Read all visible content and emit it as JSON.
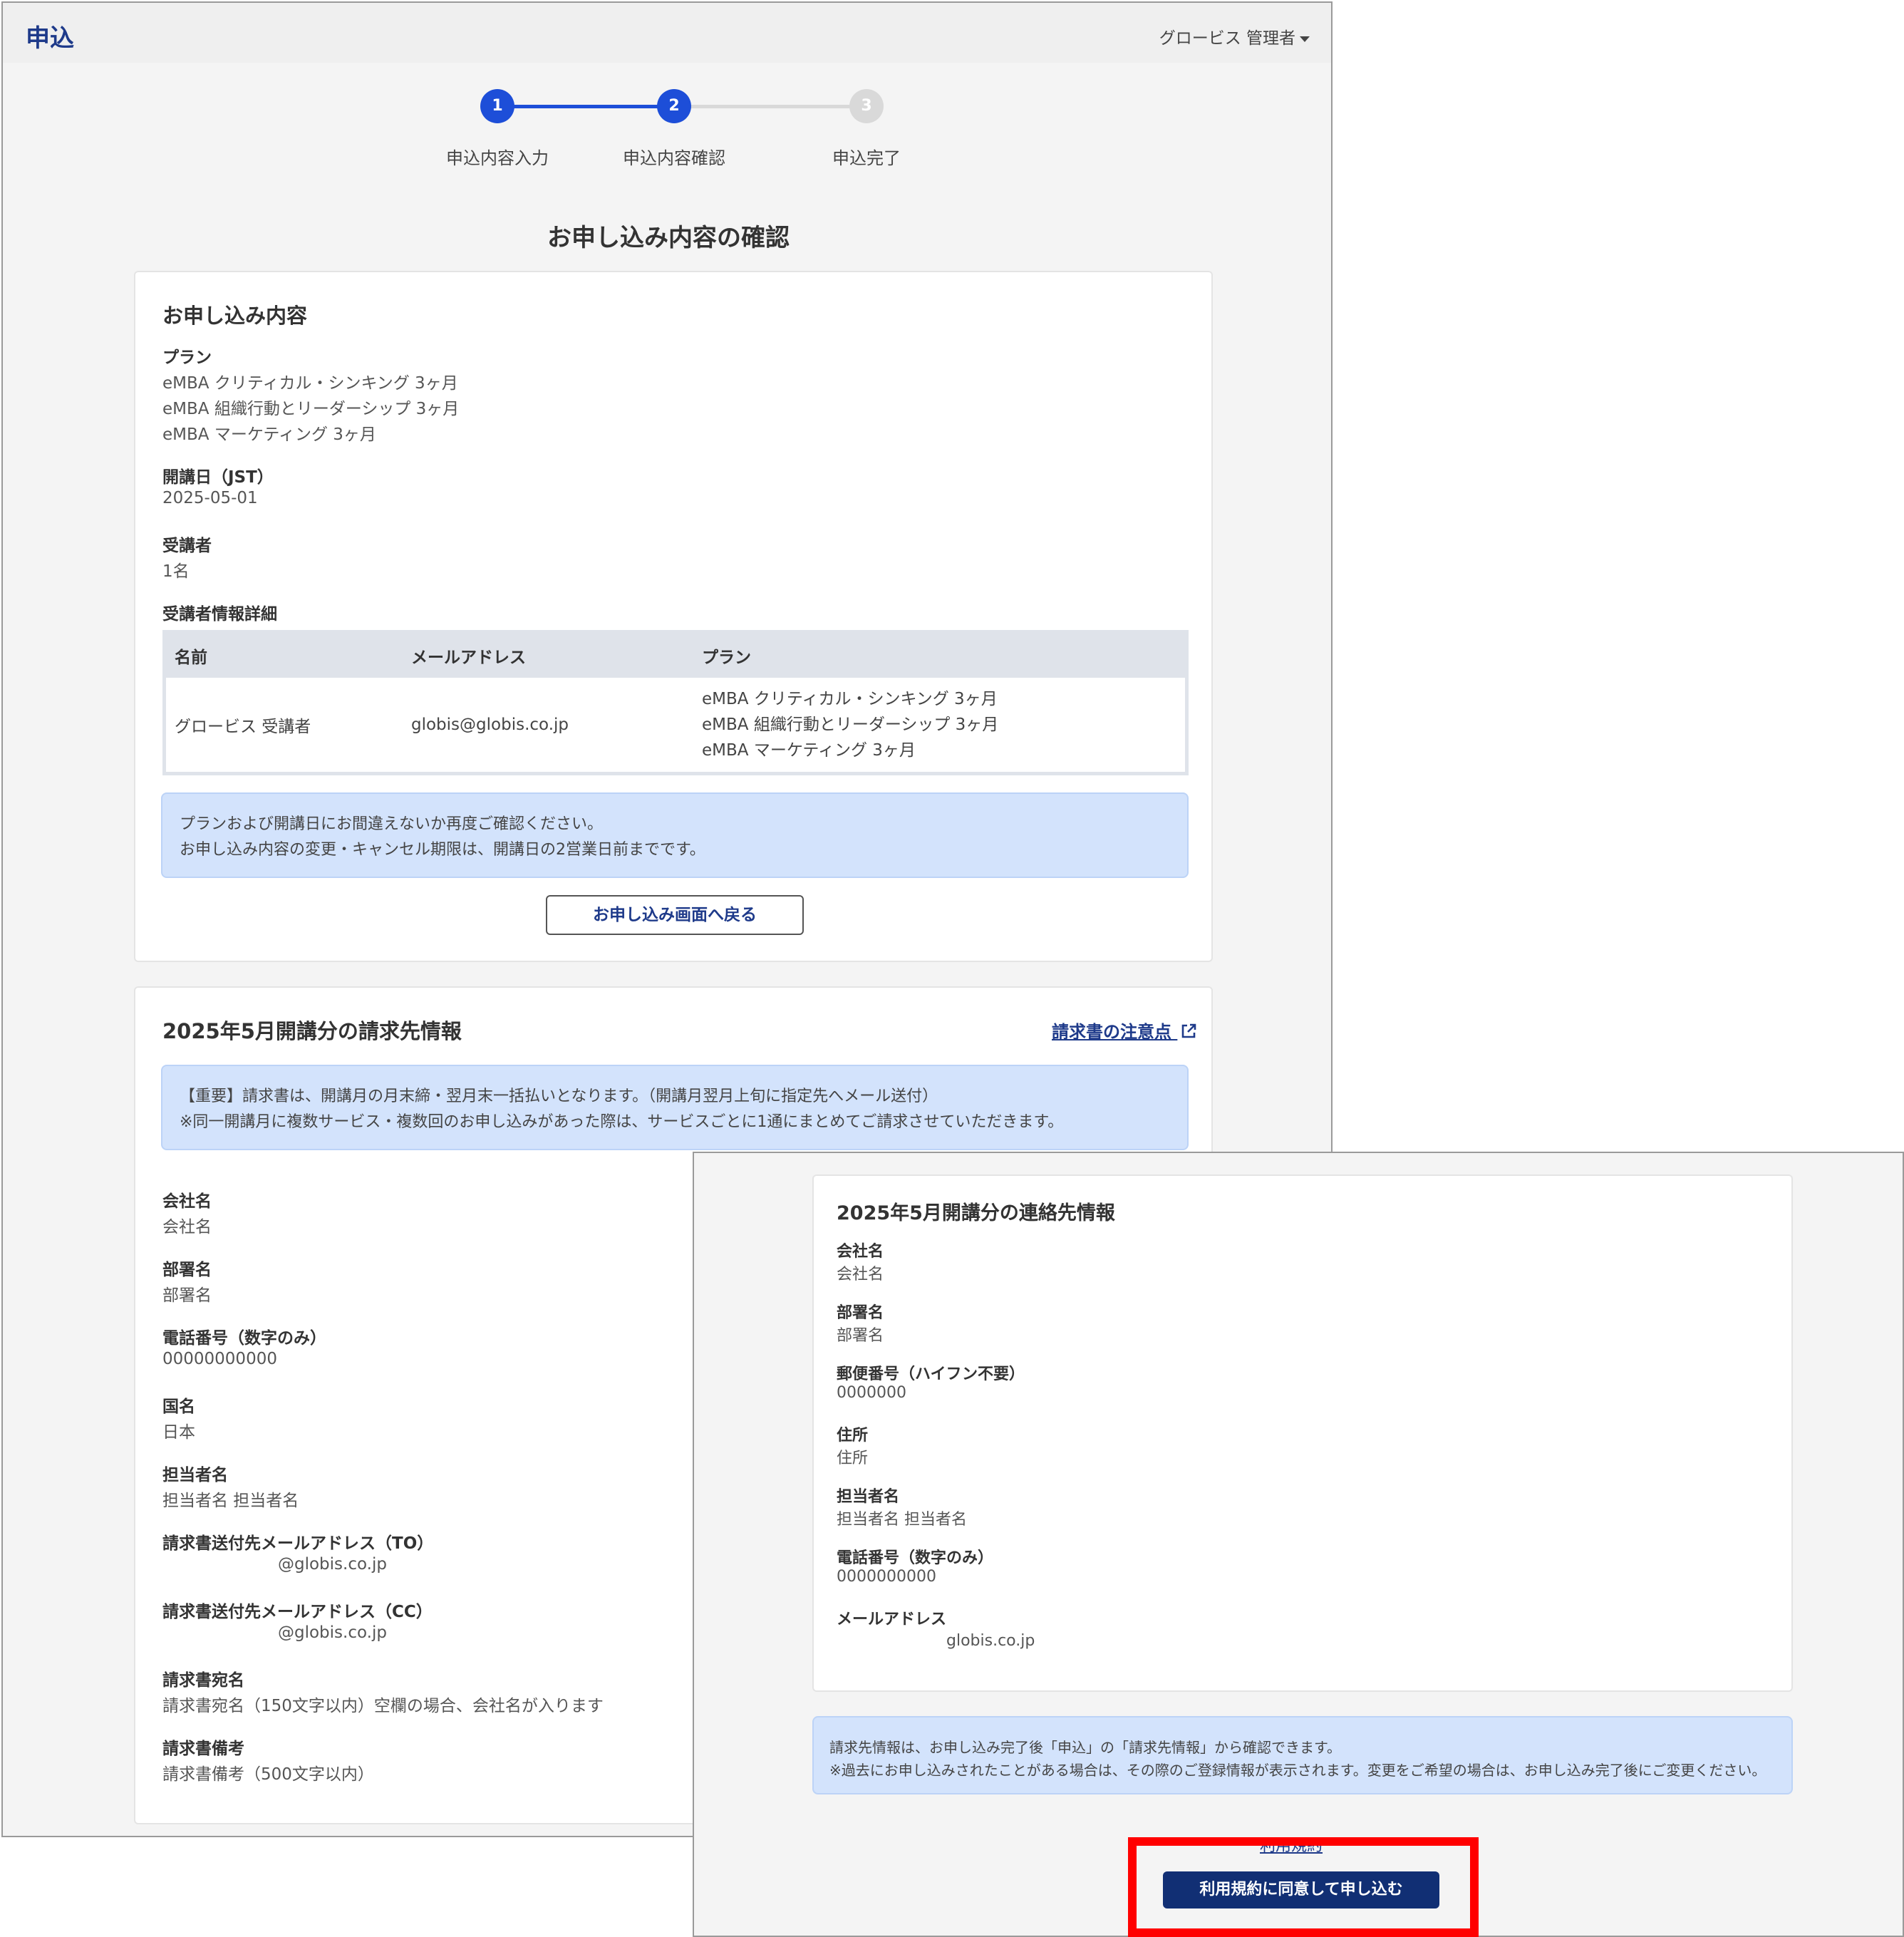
{
  "header": {
    "title": "申込",
    "user_menu": "グロービス 管理者"
  },
  "stepper": {
    "steps": [
      {
        "number": "1",
        "label": "申込内容入力",
        "state": "done"
      },
      {
        "number": "2",
        "label": "申込内容確認",
        "state": "current"
      },
      {
        "number": "3",
        "label": "申込完了",
        "state": "pending"
      }
    ],
    "active_color": "#1d4ed8",
    "inactive_color": "#d9d9d9"
  },
  "page_title": "お申し込み内容の確認",
  "application": {
    "title": "お申し込み内容",
    "plan_label": "プラン",
    "plans": [
      "eMBA クリティカル・シンキング 3ヶ月",
      "eMBA 組織行動とリーダーシップ 3ヶ月",
      "eMBA マーケティング 3ヶ月"
    ],
    "start_date_label": "開講日（JST）",
    "start_date": "2025-05-01",
    "attendees_label": "受講者",
    "attendees": "1名",
    "details_label": "受講者情報詳細",
    "table": {
      "headers": [
        "名前",
        "メールアドレス",
        "プラン"
      ],
      "rows": [
        {
          "name": "グロービス 受講者",
          "email": "globis@globis.co.jp",
          "plans": [
            "eMBA クリティカル・シンキング 3ヶ月",
            "eMBA 組織行動とリーダーシップ 3ヶ月",
            "eMBA マーケティング 3ヶ月"
          ]
        }
      ]
    },
    "notice": [
      "プランおよび開講日にお間違えないか再度ご確認ください。",
      "お申し込み内容の変更・キャンセル期限は、開講日の2営業日前までです。"
    ],
    "back_button": "お申し込み画面へ戻る"
  },
  "billing": {
    "title": "2025年5月開講分の請求先情報",
    "notes_link": "請求書の注意点",
    "notice": [
      "【重要】請求書は、開講月の月末締・翌月末一括払いとなります。（開講月翌月上旬に指定先へメール送付）",
      "※同一開講月に複数サービス・複数回のお申し込みがあった際は、サービスごとに1通にまとめてご請求させていただきます。"
    ],
    "fields": [
      {
        "label": "会社名",
        "value": "会社名"
      },
      {
        "label": "部署名",
        "value": "部署名"
      },
      {
        "label": "電話番号（数字のみ）",
        "value": "00000000000"
      },
      {
        "label": "国名",
        "value": "日本"
      },
      {
        "label": "担当者名",
        "value": "担当者名 担当者名"
      },
      {
        "label": "請求書送付先メールアドレス（TO）",
        "value": "@globis.co.jp"
      },
      {
        "label": "請求書送付先メールアドレス（CC）",
        "value": "@globis.co.jp"
      },
      {
        "label": "請求書宛名",
        "value": "請求書宛名（150文字以内）空欄の場合、会社名が入ります"
      },
      {
        "label": "請求書備考",
        "value": "請求書備考（500文字以内）"
      }
    ]
  },
  "contact": {
    "title": "2025年5月開講分の連絡先情報",
    "fields": [
      {
        "label": "会社名",
        "value": "会社名"
      },
      {
        "label": "部署名",
        "value": "部署名"
      },
      {
        "label": "郵便番号（ハイフン不要）",
        "value": "0000000"
      },
      {
        "label": "住所",
        "value": "住所"
      },
      {
        "label": "担当者名",
        "value": "担当者名 担当者名"
      },
      {
        "label": "電話番号（数字のみ）",
        "value": "0000000000"
      },
      {
        "label": "メールアドレス",
        "value": "globis.co.jp"
      }
    ],
    "notice": [
      "請求先情報は、お申し込み完了後「申込」の「請求先情報」から確認できます。",
      "※過去にお申し込みされたことがある場合は、その際のご登録情報が表示されます。変更をご希望の場合は、お申し込み完了後にご変更ください。"
    ]
  },
  "terms_link": "利用規約",
  "submit_button": "利用規約に同意して申し込む"
}
